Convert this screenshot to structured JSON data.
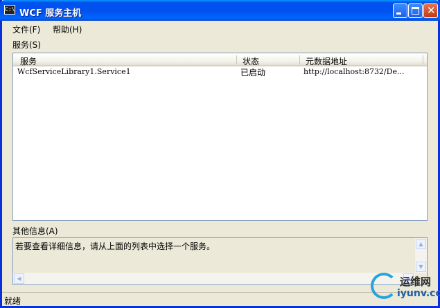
{
  "window": {
    "title": "WCF 服务主机",
    "icon_text": "C:\\",
    "controls": {
      "minimize": "minimize-icon",
      "maximize": "maximize-icon",
      "close": "close-icon"
    }
  },
  "menubar": {
    "items": [
      "文件(F)",
      "帮助(H)"
    ]
  },
  "services_section": {
    "label": "服务(S)"
  },
  "services_table": {
    "columns": [
      "服务",
      "状态",
      "元数据地址"
    ],
    "rows": [
      {
        "service": "WcfServiceLibrary1.Service1",
        "status": "已启动",
        "metadata": "http://localhost:8732/De..."
      }
    ]
  },
  "info_section": {
    "label": "其他信息(A)",
    "text": "若要查看详细信息，请从上面的列表中选择一个服务。"
  },
  "statusbar": {
    "text": "就绪"
  },
  "watermark": {
    "cn": "运维网",
    "en": "iyunv.com"
  },
  "colors": {
    "title_bar": "#0053ee",
    "window_bg": "#ece9d8",
    "list_border": "#7f9db9"
  }
}
